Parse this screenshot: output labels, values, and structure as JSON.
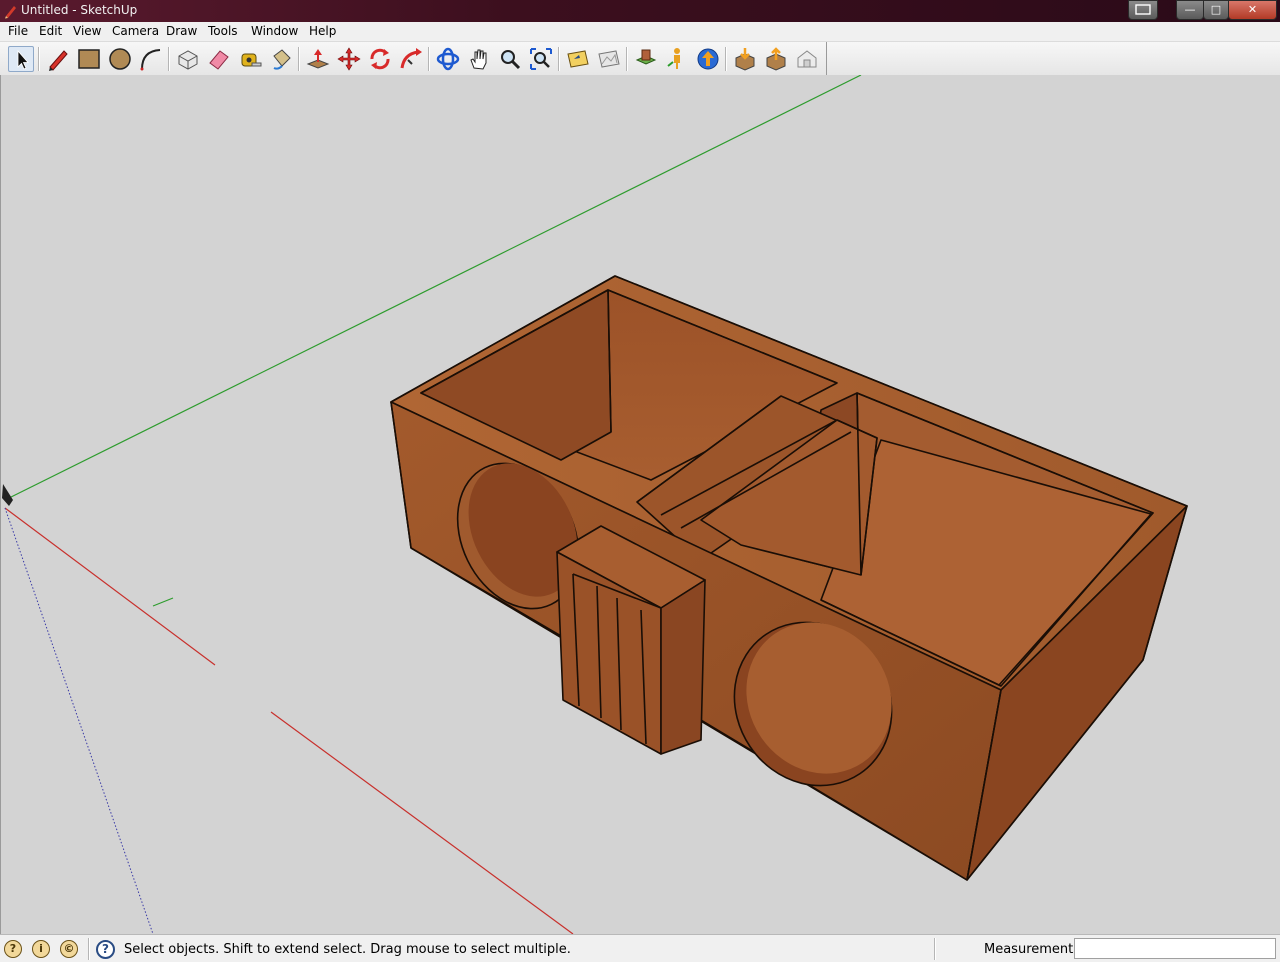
{
  "window": {
    "title": "Untitled - SketchUp",
    "buttons": [
      "—",
      "□",
      "✕"
    ]
  },
  "menu": [
    "File",
    "Edit",
    "View",
    "Camera",
    "Draw",
    "Tools",
    "Window",
    "Help"
  ],
  "toolbar": {
    "tools": [
      {
        "name": "select",
        "icon": "arrow-cursor-icon",
        "active": true
      },
      {
        "name": "line",
        "icon": "pencil-icon"
      },
      {
        "name": "rectangle",
        "icon": "rectangle-icon"
      },
      {
        "name": "circle",
        "icon": "circle-icon"
      },
      {
        "name": "arc",
        "icon": "arc-icon"
      },
      {
        "name": "make-component",
        "icon": "component-icon"
      },
      {
        "name": "eraser",
        "icon": "eraser-icon"
      },
      {
        "name": "tape-measure",
        "icon": "tape-measure-icon"
      },
      {
        "name": "paint-bucket",
        "icon": "paint-bucket-icon"
      },
      {
        "name": "push-pull",
        "icon": "push-pull-icon"
      },
      {
        "name": "move",
        "icon": "move-icon"
      },
      {
        "name": "rotate",
        "icon": "rotate-icon"
      },
      {
        "name": "follow-me",
        "icon": "follow-me-icon"
      },
      {
        "name": "orbit",
        "icon": "orbit-icon"
      },
      {
        "name": "pan",
        "icon": "hand-icon"
      },
      {
        "name": "zoom",
        "icon": "magnifier-icon"
      },
      {
        "name": "zoom-extents",
        "icon": "zoom-extents-icon"
      },
      {
        "name": "add-location",
        "icon": "add-location-icon"
      },
      {
        "name": "toggle-terrain",
        "icon": "terrain-icon"
      },
      {
        "name": "photo-textures",
        "icon": "photo-textures-icon"
      },
      {
        "name": "street-view",
        "icon": "street-view-icon"
      },
      {
        "name": "share-model",
        "icon": "share-model-icon"
      },
      {
        "name": "get-models",
        "icon": "get-models-icon"
      },
      {
        "name": "share-component",
        "icon": "share-component-icon"
      },
      {
        "name": "extension-warehouse",
        "icon": "extension-warehouse-icon"
      }
    ]
  },
  "colors": {
    "wood_dark": "#8a4a22",
    "wood_mid": "#a45a2c",
    "wood_light": "#b86a38",
    "axis_red": "#c8302c",
    "axis_green": "#2e9c2e",
    "axis_blue": "#3a3aa6",
    "viewport_bg": "#d3d3d3"
  },
  "status": {
    "instructor_icons": [
      "geo-location-icon",
      "credits-icon",
      "copyright-icon"
    ],
    "help_icon": "help-icon",
    "message": "Select objects. Shift to extend select. Drag mouse to select multiple.",
    "measurements_label": "Measurements",
    "measurements_value": ""
  }
}
